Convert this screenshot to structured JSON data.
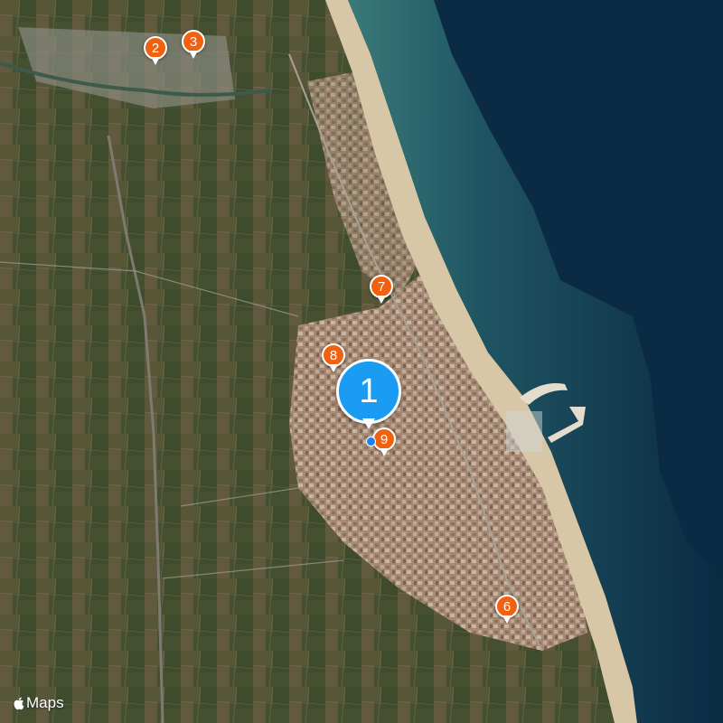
{
  "map": {
    "colors": {
      "sea_deep": "#0b2a43",
      "sea_shallow": "#2f6f76",
      "beach": "#d8c7a6",
      "urban": "#b89a86",
      "fields": "#4a4f33",
      "cluster_pin": "#1a9cf2",
      "place_pin": "#f2610f"
    }
  },
  "markers": {
    "selected": {
      "label": "1"
    },
    "m2": {
      "label": "2"
    },
    "m3": {
      "label": "3"
    },
    "m6": {
      "label": "6"
    },
    "m7": {
      "label": "7"
    },
    "m8": {
      "label": "8"
    },
    "m9": {
      "label": "9"
    }
  },
  "attribution": {
    "text": "Maps",
    "icon": "apple-logo-icon"
  }
}
